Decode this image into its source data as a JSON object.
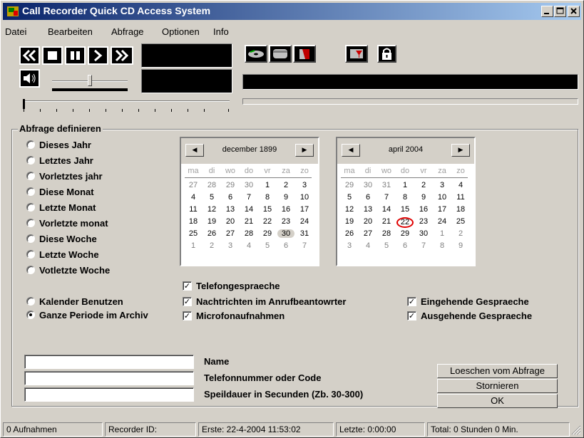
{
  "window": {
    "title": "Call Recorder Quick CD Access System"
  },
  "menu": [
    "Datei",
    "Bearbeiten",
    "Abfrage",
    "Optionen",
    "Info"
  ],
  "group": {
    "label": "Abfrage definieren"
  },
  "radios": [
    {
      "label": "Dieses Jahr",
      "checked": false
    },
    {
      "label": "Letztes Jahr",
      "checked": false
    },
    {
      "label": "Vorletztes jahr",
      "checked": false
    },
    {
      "label": "Diese Monat",
      "checked": false
    },
    {
      "label": "Letzte Monat",
      "checked": false
    },
    {
      "label": "Vorletzte monat",
      "checked": false
    },
    {
      "label": "Diese Woche",
      "checked": false
    },
    {
      "label": "Letzte Woche",
      "checked": false
    },
    {
      "label": "Votletzte Woche",
      "checked": false
    },
    {
      "label": "Kalender Benutzen",
      "checked": false
    },
    {
      "label": "Ganze Periode im Archiv",
      "checked": true
    }
  ],
  "calendar_left": {
    "title": "december 1899",
    "weekdays": [
      "ma",
      "di",
      "wo",
      "do",
      "vr",
      "za",
      "zo"
    ],
    "days": [
      [
        "27",
        "28",
        "29",
        "30",
        "1",
        "2",
        "3"
      ],
      [
        "4",
        "5",
        "6",
        "7",
        "8",
        "9",
        "10"
      ],
      [
        "11",
        "12",
        "13",
        "14",
        "15",
        "16",
        "17"
      ],
      [
        "18",
        "19",
        "20",
        "21",
        "22",
        "23",
        "24"
      ],
      [
        "25",
        "26",
        "27",
        "28",
        "29",
        "30",
        "31"
      ],
      [
        "1",
        "2",
        "3",
        "4",
        "5",
        "6",
        "7"
      ]
    ],
    "selected": "30"
  },
  "calendar_right": {
    "title": "april 2004",
    "weekdays": [
      "ma",
      "di",
      "wo",
      "do",
      "vr",
      "za",
      "zo"
    ],
    "days": [
      [
        "29",
        "30",
        "31",
        "1",
        "2",
        "3",
        "4"
      ],
      [
        "5",
        "6",
        "7",
        "8",
        "9",
        "10",
        "11"
      ],
      [
        "12",
        "13",
        "14",
        "15",
        "16",
        "17",
        "18"
      ],
      [
        "19",
        "20",
        "21",
        "22",
        "23",
        "24",
        "25"
      ],
      [
        "26",
        "27",
        "28",
        "29",
        "30",
        "1",
        "2"
      ],
      [
        "3",
        "4",
        "5",
        "6",
        "7",
        "8",
        "9"
      ]
    ],
    "today": "22"
  },
  "checkboxes_left": [
    {
      "label": "Telefongespraeche",
      "checked": true
    },
    {
      "label": "Nachtrichten im Anrufbeantowrter",
      "checked": true
    },
    {
      "label": "Microfonaufnahmen",
      "checked": true
    }
  ],
  "checkboxes_right": [
    {
      "label": "Eingehende Gespraeche",
      "checked": true
    },
    {
      "label": "Ausgehende Gespraeche",
      "checked": true
    }
  ],
  "fields": [
    {
      "label": "Name",
      "value": ""
    },
    {
      "label": "Telefonnummer oder Code",
      "value": ""
    },
    {
      "label": "Speildauer in Secunden (Zb. 30-300)",
      "value": ""
    }
  ],
  "buttons": {
    "delete": "Loeschen vom Abfrage",
    "cancel": "Stornieren",
    "ok": "OK"
  },
  "status": {
    "count": "0 Aufnahmen",
    "recorder": "Recorder ID:",
    "first": "Erste:  22-4-2004 11:53:02",
    "last": "Letzte:  0:00:00",
    "total": "Total: 0 Stunden 0 Min."
  }
}
